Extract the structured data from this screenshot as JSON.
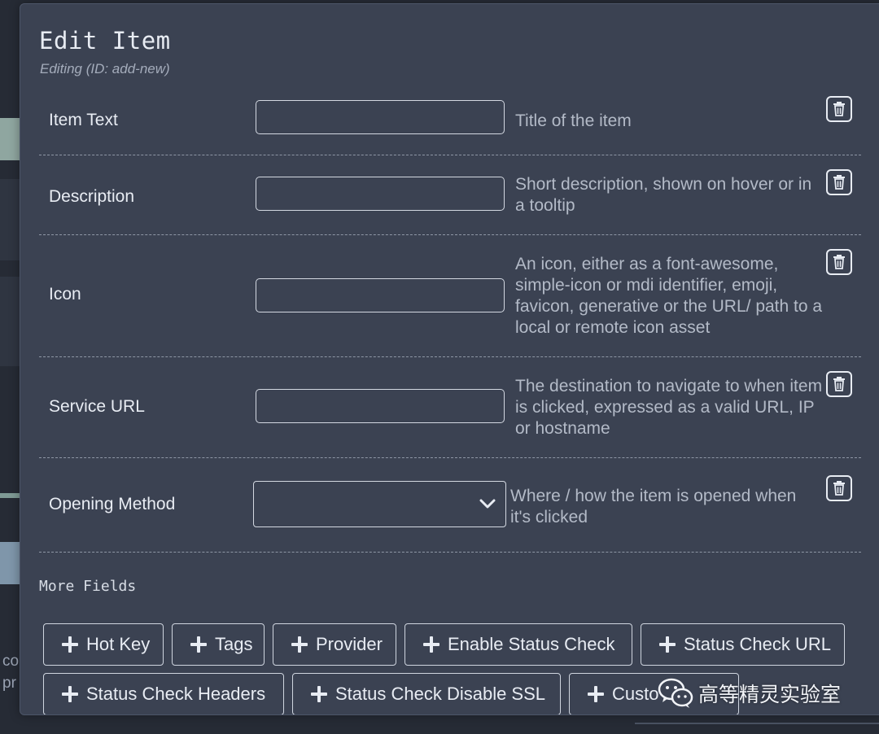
{
  "background": {
    "snippet_line1": "co",
    "snippet_line2": "pr"
  },
  "modal": {
    "title": "Edit Item",
    "subtitle": "Editing (ID: add-new)",
    "fields": [
      {
        "label": "Item Text",
        "value": "",
        "help": "Title of the item",
        "control": "text",
        "remove_icon": "trash-icon"
      },
      {
        "label": "Description",
        "value": "",
        "help": "Short description, shown on hover or in a tooltip",
        "control": "text",
        "remove_icon": "trash-icon"
      },
      {
        "label": "Icon",
        "value": "",
        "help": "An icon, either as a font-awesome, simple-icon or mdi identifier, emoji, favicon, generative or the URL/ path to a local or remote icon asset",
        "control": "text",
        "remove_icon": "trash-icon"
      },
      {
        "label": "Service URL",
        "value": "",
        "help": "The destination to navigate to when item is clicked, expressed as a valid URL, IP or hostname",
        "control": "text",
        "remove_icon": "trash-icon"
      },
      {
        "label": "Opening Method",
        "value": "",
        "help": "Where / how the item is opened when it's clicked",
        "control": "select",
        "remove_icon": "trash-icon"
      }
    ],
    "more_fields_label": "More Fields",
    "more_fields": [
      "Hot Key",
      "Tags",
      "Provider",
      "Enable Status Check",
      "Status Check URL",
      "Status Check Headers",
      "Status Check Disable SSL",
      "Custo"
    ]
  },
  "watermark": {
    "text": "高等精灵实验室",
    "icon": "wechat-icon"
  },
  "colors": {
    "modal_bg": "#3b4252",
    "page_bg": "#262b35",
    "text": "#e8ecf3",
    "muted_text": "#b3bac7"
  }
}
